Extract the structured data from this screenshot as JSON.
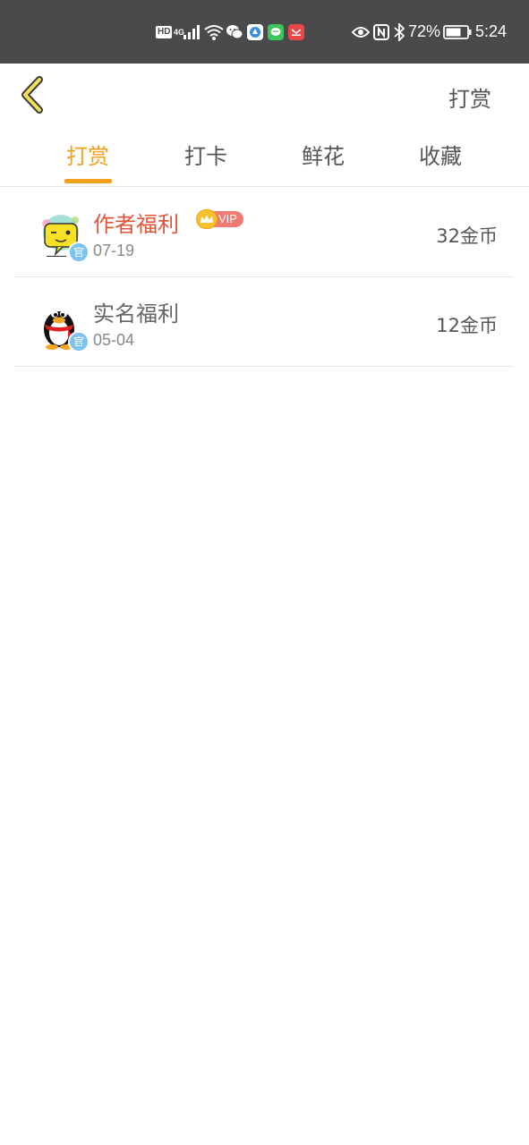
{
  "status_bar": {
    "network": "4G",
    "hd": "HD",
    "battery_percent": "72%",
    "time": "5:24",
    "icons": [
      "hd-icon",
      "4g-icon",
      "signal-icon",
      "wifi-icon",
      "wechat-icon",
      "app-icon",
      "chat-icon",
      "app-icon",
      "eye-icon",
      "nfc-icon",
      "bluetooth-icon",
      "battery-icon"
    ]
  },
  "header": {
    "back_icon": "chevron-left-icon",
    "action_label": "打赏"
  },
  "tabs": [
    {
      "label": "打赏",
      "active": true
    },
    {
      "label": "打卡",
      "active": false
    },
    {
      "label": "鲜花",
      "active": false
    },
    {
      "label": "收藏",
      "active": false
    }
  ],
  "colors": {
    "accent": "#f0a21a",
    "vip_name": "#e2553a",
    "status_bar": "#4a4a4a",
    "official_badge": "#7cc4ee"
  },
  "records": [
    {
      "name": "作者福利",
      "vip": true,
      "vip_label": "VIP",
      "official_badge": "官",
      "date": "07-19",
      "amount": "32金币",
      "avatar": "speech-bubble-avatar"
    },
    {
      "name": "实名福利",
      "vip": false,
      "official_badge": "官",
      "date": "05-04",
      "amount": "12金币",
      "avatar": "penguin-avatar"
    }
  ]
}
